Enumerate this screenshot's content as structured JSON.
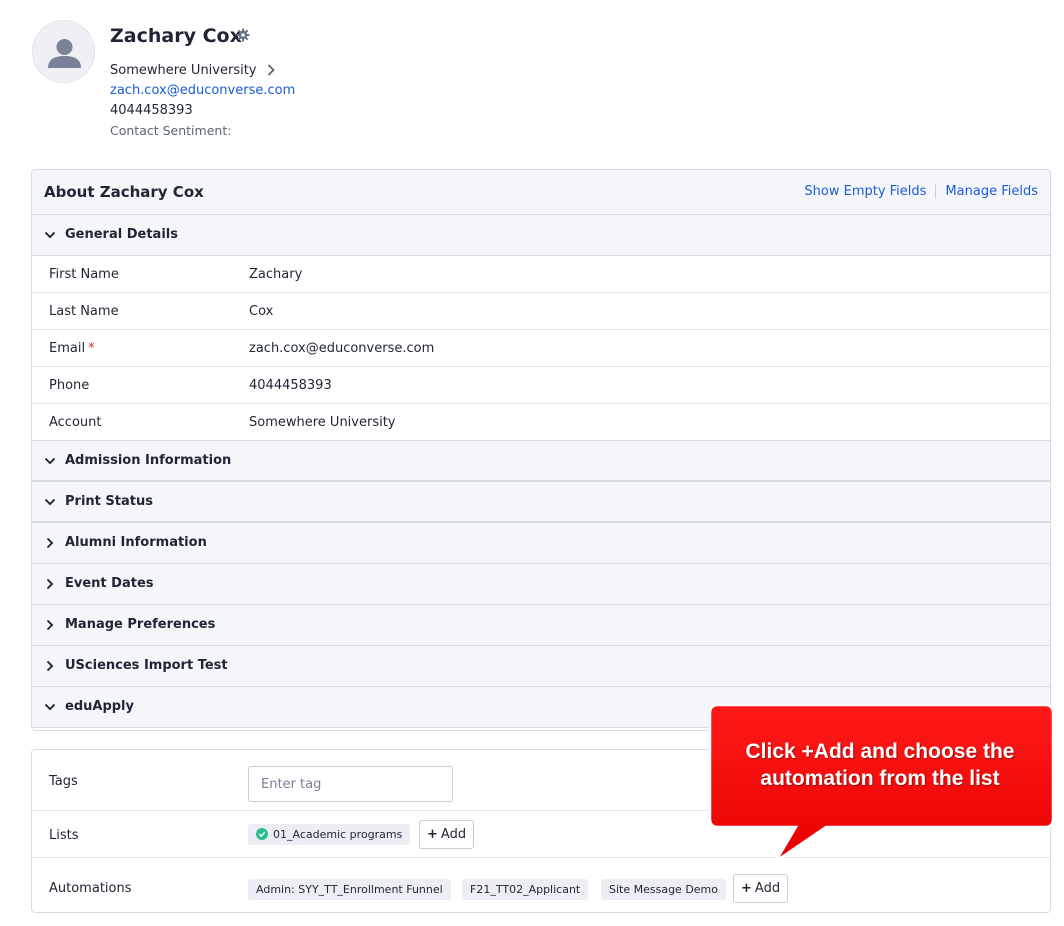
{
  "contact": {
    "name": "Zachary Cox",
    "account": "Somewhere University",
    "email": "zach.cox@educonverse.com",
    "phone": "4044458393",
    "sentiment_label": "Contact Sentiment:"
  },
  "about": {
    "title": "About Zachary Cox",
    "show_empty_fields": "Show Empty Fields",
    "manage_fields": "Manage Fields",
    "general_details_label": "General Details",
    "fields": [
      {
        "label": "First Name",
        "value": "Zachary"
      },
      {
        "label": "Last Name",
        "value": "Cox"
      },
      {
        "label": "Email",
        "value": "zach.cox@educonverse.com",
        "required_mark": "*"
      },
      {
        "label": "Phone",
        "value": "4044458393"
      },
      {
        "label": "Account",
        "value": "Somewhere University"
      }
    ],
    "sections": [
      {
        "label": "Admission Information",
        "expanded": true
      },
      {
        "label": "Print Status",
        "expanded": true
      },
      {
        "label": "Alumni Information",
        "expanded": false
      },
      {
        "label": "Event Dates",
        "expanded": false
      },
      {
        "label": "Manage Preferences",
        "expanded": false
      },
      {
        "label": "USciences Import Test",
        "expanded": false
      },
      {
        "label": "eduApply",
        "expanded": true
      }
    ]
  },
  "meta": {
    "tags_label": "Tags",
    "tag_placeholder": "Enter tag",
    "lists_label": "Lists",
    "lists": [
      "01_Academic programs"
    ],
    "automations_label": "Automations",
    "automations": [
      "Admin: SYY_TT_Enrollment Funnel",
      "F21_TT02_Applicant",
      "Site Message Demo"
    ],
    "add_label": "Add"
  },
  "callout": {
    "line1": "Click +Add and choose the",
    "line2": "automation from the list",
    "color": "#ff0000"
  },
  "colors": {
    "link": "#1a5bd6",
    "panel_header": "#f5f6fa",
    "check": "#2bbf8e"
  }
}
